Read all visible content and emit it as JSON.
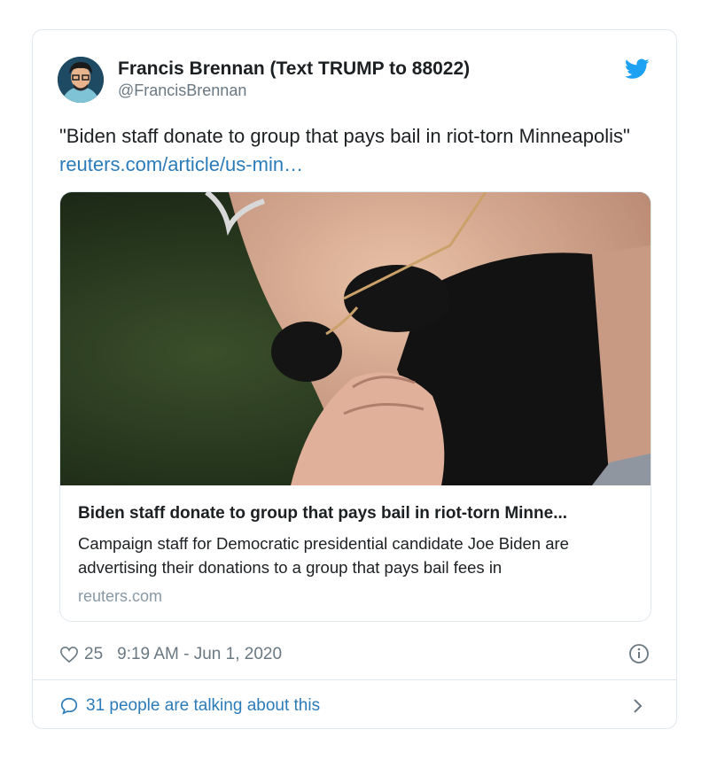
{
  "tweet": {
    "author_name": "Francis Brennan (Text TRUMP to 88022)",
    "handle": "@FrancisBrennan",
    "text": "\"Biden staff donate to group that pays bail in riot-torn Minneapolis\" ",
    "link_text": "reuters.com/article/us-min…",
    "card": {
      "title": "Biden staff donate to group that pays bail in riot-torn Minne...",
      "description": "Campaign staff for Democratic presidential candidate Joe Biden are advertising their donations to a group that pays bail fees in",
      "domain": "reuters.com"
    },
    "likes": "25",
    "timestamp": "9:19 AM - Jun 1, 2020",
    "talking": "31 people are talking about this"
  },
  "colors": {
    "link": "#2b7bb9",
    "twitter_blue": "#1da1f2",
    "border": "#e1e8ed",
    "secondary_text": "#697882"
  },
  "icons": [
    "twitter-bird-icon",
    "heart-icon",
    "info-icon",
    "speech-bubble-icon",
    "chevron-right-icon"
  ]
}
